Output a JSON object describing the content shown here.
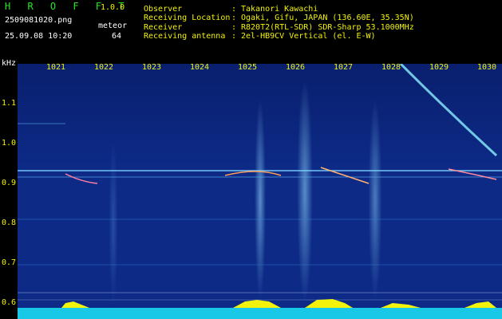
{
  "header": {
    "brand": "H R O F F T",
    "version": "1.0.0",
    "filename": "2509081020.png",
    "counter_label": "meteor",
    "datetime": "25.09.08 10:20",
    "counter_value": "64"
  },
  "station_info": [
    {
      "key": "Observer",
      "sep": ":",
      "value": "Takanori Kawachi"
    },
    {
      "key": "Receiving Location",
      "sep": ":",
      "value": "Ogaki, Gifu, JAPAN (136.60E, 35.35N)"
    },
    {
      "key": "Receiver",
      "sep": ":",
      "value": "R820T2(RTL-SDR) SDR-Sharp 53.1000MHz"
    },
    {
      "key": "Receiving antenna",
      "sep": ":",
      "value": "2el-HB9CV Vertical (el. E-W)"
    }
  ],
  "axis": {
    "y_unit": "kHz",
    "y_ticks": [
      "1.1",
      "1.0",
      "0.9",
      "0.8",
      "0.7",
      "0.6"
    ],
    "x_ticks": [
      "1021",
      "1022",
      "1023",
      "1024",
      "1025",
      "1026",
      "1027",
      "1028",
      "1029",
      "1030"
    ]
  },
  "colors": {
    "background": "#0c2a86",
    "title_green": "#22e822",
    "label_yellow": "#f2f20a",
    "baseline_cyan": "#19c8e6"
  }
}
